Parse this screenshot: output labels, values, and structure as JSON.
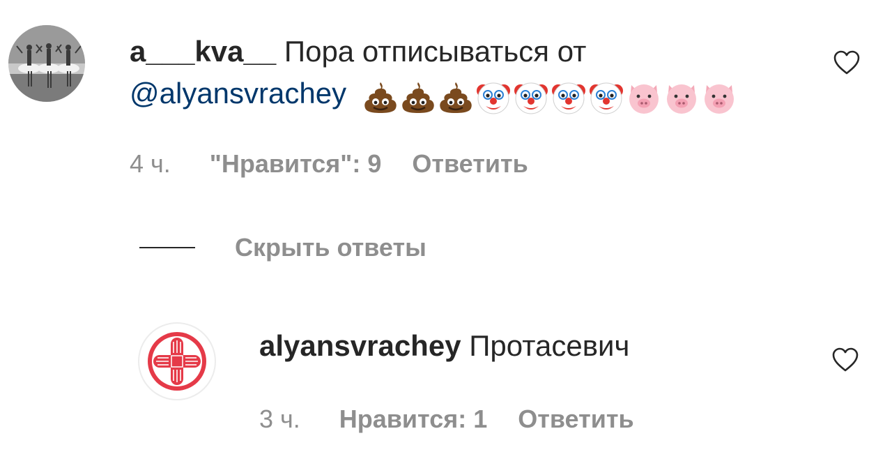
{
  "comments": [
    {
      "username": "a___kva__",
      "text": "Пора отписываться от",
      "mention": "@alyansvrachey",
      "emojis": [
        "poop-emoji",
        "poop-emoji",
        "poop-emoji",
        "clown-emoji",
        "clown-emoji",
        "clown-emoji",
        "clown-emoji",
        "pig-emoji",
        "pig-emoji",
        "pig-emoji"
      ],
      "time": "4 ч.",
      "likes": "\"Нравится\": 9",
      "reply_label": "Ответить",
      "avatar": "ballet-dancers-photo"
    },
    {
      "username": "alyansvrachey",
      "text": "Протасевич",
      "time": "3 ч.",
      "likes": "Нравится: 1",
      "reply_label": "Ответить",
      "avatar": "red-cross-hands-logo"
    }
  ],
  "replies_toggle": {
    "label": "Скрыть ответы"
  },
  "colors": {
    "text": "#262626",
    "secondary": "#8e8e8e",
    "mention": "#00376b",
    "logo_red": "#e53a48"
  }
}
